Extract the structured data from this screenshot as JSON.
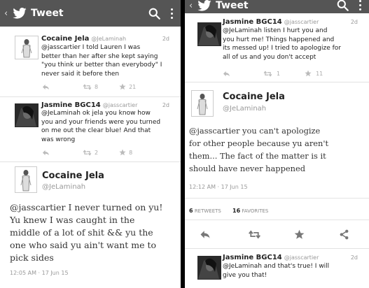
{
  "left": {
    "title": "Tweet",
    "tweets": [
      {
        "name": "Cocaine Jela",
        "handle": "@JeLaminah",
        "time": "2d",
        "text": "@jasscartier I told Lauren I was\nbetter than her after she kept saying\n\"you think ur better than everybody\" I\nnever said it before then",
        "retweets": "8",
        "favorites": "21"
      },
      {
        "name": "Jasmine BGC14",
        "handle": "@jasscartier",
        "time": "2d",
        "text": "@JeLaminah ok jela you know how\nyou and your friends were you turned\non me out the clear blue! And that\nwas wrong",
        "retweets": "2",
        "favorites": "8"
      }
    ],
    "focus": {
      "name": "Cocaine Jela",
      "handle": "@JeLaminah",
      "text": "@jasscartier I never turned on yu!\nYu knew I was caught in the\nmiddle of a lot of shit && yu the\none who said yu ain't want me to\npick sides",
      "timestamp": "12:05 AM · 17 Jun 15"
    }
  },
  "right": {
    "title": "Tweet",
    "top_tweet": {
      "name": "Jasmine BGC14",
      "handle": "@jasscartier",
      "time": "2d",
      "text": "@JeLaminah listen I hurt you and\nyou hurt me! Things happened and\nits messed up! I tried to apologize for\nall of us and you don't accept",
      "retweets": "1",
      "favorites": "11"
    },
    "focus": {
      "name": "Cocaine Jela",
      "handle": "@JeLaminah",
      "text": "@jasscartier you can't apologize\nfor other people because yu aren't\nthem... The fact of the matter is it\nshould have never happened",
      "timestamp": "12:12 AM · 17 Jun 15",
      "retweets_count": "6",
      "retweets_label": "RETWEETS",
      "favorites_count": "16",
      "favorites_label": "FAVORITES"
    },
    "bottom_tweet": {
      "name": "Jasmine BGC14",
      "handle": "@jasscartier",
      "time": "2d",
      "text": "@JeLaminah and that's true! I will\ngive you that!"
    }
  }
}
